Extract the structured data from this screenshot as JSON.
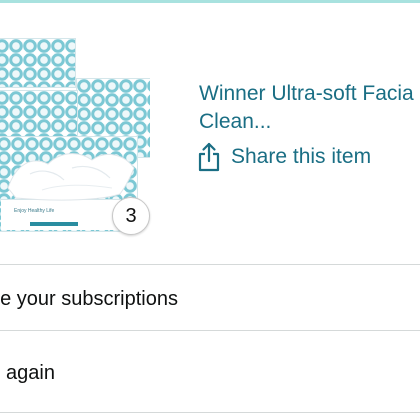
{
  "product": {
    "title_line1": "Winner Ultra-soft Facia",
    "title_line2": "Clean...",
    "quantity": "3",
    "image_label": "Enjoy Healthy Life",
    "share_label": "Share this item"
  },
  "actions": {
    "manage_subscriptions": "ge your subscriptions",
    "buy_again": "again"
  },
  "colors": {
    "link": "#1a6e84",
    "text": "#0f1111",
    "divider": "#d5d9d9",
    "top_accent": "#a8e2df"
  },
  "icons": {
    "share": "share-icon"
  }
}
